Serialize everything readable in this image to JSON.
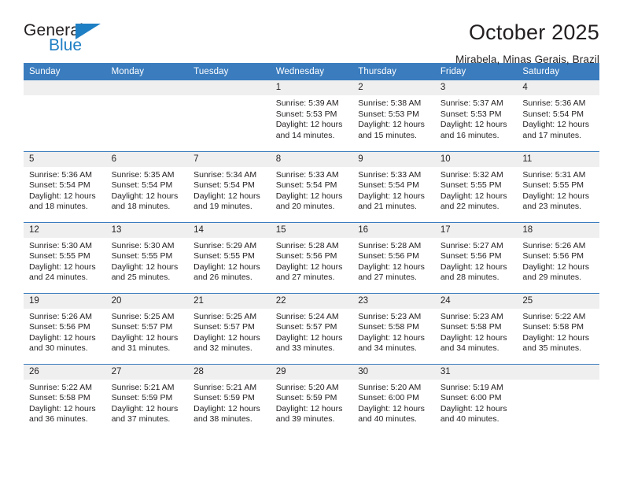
{
  "brand": {
    "name_part1": "General",
    "name_part2": "Blue",
    "triangle_icon": "triangle-icon",
    "accent_color": "#1f7fc4"
  },
  "header": {
    "title": "October 2025",
    "location": "Mirabela, Minas Gerais, Brazil"
  },
  "calendar": {
    "header_bg": "#3a7cbe",
    "daynum_bg": "#efefef",
    "weekdays": [
      "Sunday",
      "Monday",
      "Tuesday",
      "Wednesday",
      "Thursday",
      "Friday",
      "Saturday"
    ],
    "weeks": [
      [
        {
          "day": "",
          "sunrise": "",
          "sunset": "",
          "daylight_line1": "",
          "daylight_line2": ""
        },
        {
          "day": "",
          "sunrise": "",
          "sunset": "",
          "daylight_line1": "",
          "daylight_line2": ""
        },
        {
          "day": "",
          "sunrise": "",
          "sunset": "",
          "daylight_line1": "",
          "daylight_line2": ""
        },
        {
          "day": "1",
          "sunrise": "Sunrise: 5:39 AM",
          "sunset": "Sunset: 5:53 PM",
          "daylight_line1": "Daylight: 12 hours",
          "daylight_line2": "and 14 minutes."
        },
        {
          "day": "2",
          "sunrise": "Sunrise: 5:38 AM",
          "sunset": "Sunset: 5:53 PM",
          "daylight_line1": "Daylight: 12 hours",
          "daylight_line2": "and 15 minutes."
        },
        {
          "day": "3",
          "sunrise": "Sunrise: 5:37 AM",
          "sunset": "Sunset: 5:53 PM",
          "daylight_line1": "Daylight: 12 hours",
          "daylight_line2": "and 16 minutes."
        },
        {
          "day": "4",
          "sunrise": "Sunrise: 5:36 AM",
          "sunset": "Sunset: 5:54 PM",
          "daylight_line1": "Daylight: 12 hours",
          "daylight_line2": "and 17 minutes."
        }
      ],
      [
        {
          "day": "5",
          "sunrise": "Sunrise: 5:36 AM",
          "sunset": "Sunset: 5:54 PM",
          "daylight_line1": "Daylight: 12 hours",
          "daylight_line2": "and 18 minutes."
        },
        {
          "day": "6",
          "sunrise": "Sunrise: 5:35 AM",
          "sunset": "Sunset: 5:54 PM",
          "daylight_line1": "Daylight: 12 hours",
          "daylight_line2": "and 18 minutes."
        },
        {
          "day": "7",
          "sunrise": "Sunrise: 5:34 AM",
          "sunset": "Sunset: 5:54 PM",
          "daylight_line1": "Daylight: 12 hours",
          "daylight_line2": "and 19 minutes."
        },
        {
          "day": "8",
          "sunrise": "Sunrise: 5:33 AM",
          "sunset": "Sunset: 5:54 PM",
          "daylight_line1": "Daylight: 12 hours",
          "daylight_line2": "and 20 minutes."
        },
        {
          "day": "9",
          "sunrise": "Sunrise: 5:33 AM",
          "sunset": "Sunset: 5:54 PM",
          "daylight_line1": "Daylight: 12 hours",
          "daylight_line2": "and 21 minutes."
        },
        {
          "day": "10",
          "sunrise": "Sunrise: 5:32 AM",
          "sunset": "Sunset: 5:55 PM",
          "daylight_line1": "Daylight: 12 hours",
          "daylight_line2": "and 22 minutes."
        },
        {
          "day": "11",
          "sunrise": "Sunrise: 5:31 AM",
          "sunset": "Sunset: 5:55 PM",
          "daylight_line1": "Daylight: 12 hours",
          "daylight_line2": "and 23 minutes."
        }
      ],
      [
        {
          "day": "12",
          "sunrise": "Sunrise: 5:30 AM",
          "sunset": "Sunset: 5:55 PM",
          "daylight_line1": "Daylight: 12 hours",
          "daylight_line2": "and 24 minutes."
        },
        {
          "day": "13",
          "sunrise": "Sunrise: 5:30 AM",
          "sunset": "Sunset: 5:55 PM",
          "daylight_line1": "Daylight: 12 hours",
          "daylight_line2": "and 25 minutes."
        },
        {
          "day": "14",
          "sunrise": "Sunrise: 5:29 AM",
          "sunset": "Sunset: 5:55 PM",
          "daylight_line1": "Daylight: 12 hours",
          "daylight_line2": "and 26 minutes."
        },
        {
          "day": "15",
          "sunrise": "Sunrise: 5:28 AM",
          "sunset": "Sunset: 5:56 PM",
          "daylight_line1": "Daylight: 12 hours",
          "daylight_line2": "and 27 minutes."
        },
        {
          "day": "16",
          "sunrise": "Sunrise: 5:28 AM",
          "sunset": "Sunset: 5:56 PM",
          "daylight_line1": "Daylight: 12 hours",
          "daylight_line2": "and 27 minutes."
        },
        {
          "day": "17",
          "sunrise": "Sunrise: 5:27 AM",
          "sunset": "Sunset: 5:56 PM",
          "daylight_line1": "Daylight: 12 hours",
          "daylight_line2": "and 28 minutes."
        },
        {
          "day": "18",
          "sunrise": "Sunrise: 5:26 AM",
          "sunset": "Sunset: 5:56 PM",
          "daylight_line1": "Daylight: 12 hours",
          "daylight_line2": "and 29 minutes."
        }
      ],
      [
        {
          "day": "19",
          "sunrise": "Sunrise: 5:26 AM",
          "sunset": "Sunset: 5:56 PM",
          "daylight_line1": "Daylight: 12 hours",
          "daylight_line2": "and 30 minutes."
        },
        {
          "day": "20",
          "sunrise": "Sunrise: 5:25 AM",
          "sunset": "Sunset: 5:57 PM",
          "daylight_line1": "Daylight: 12 hours",
          "daylight_line2": "and 31 minutes."
        },
        {
          "day": "21",
          "sunrise": "Sunrise: 5:25 AM",
          "sunset": "Sunset: 5:57 PM",
          "daylight_line1": "Daylight: 12 hours",
          "daylight_line2": "and 32 minutes."
        },
        {
          "day": "22",
          "sunrise": "Sunrise: 5:24 AM",
          "sunset": "Sunset: 5:57 PM",
          "daylight_line1": "Daylight: 12 hours",
          "daylight_line2": "and 33 minutes."
        },
        {
          "day": "23",
          "sunrise": "Sunrise: 5:23 AM",
          "sunset": "Sunset: 5:58 PM",
          "daylight_line1": "Daylight: 12 hours",
          "daylight_line2": "and 34 minutes."
        },
        {
          "day": "24",
          "sunrise": "Sunrise: 5:23 AM",
          "sunset": "Sunset: 5:58 PM",
          "daylight_line1": "Daylight: 12 hours",
          "daylight_line2": "and 34 minutes."
        },
        {
          "day": "25",
          "sunrise": "Sunrise: 5:22 AM",
          "sunset": "Sunset: 5:58 PM",
          "daylight_line1": "Daylight: 12 hours",
          "daylight_line2": "and 35 minutes."
        }
      ],
      [
        {
          "day": "26",
          "sunrise": "Sunrise: 5:22 AM",
          "sunset": "Sunset: 5:58 PM",
          "daylight_line1": "Daylight: 12 hours",
          "daylight_line2": "and 36 minutes."
        },
        {
          "day": "27",
          "sunrise": "Sunrise: 5:21 AM",
          "sunset": "Sunset: 5:59 PM",
          "daylight_line1": "Daylight: 12 hours",
          "daylight_line2": "and 37 minutes."
        },
        {
          "day": "28",
          "sunrise": "Sunrise: 5:21 AM",
          "sunset": "Sunset: 5:59 PM",
          "daylight_line1": "Daylight: 12 hours",
          "daylight_line2": "and 38 minutes."
        },
        {
          "day": "29",
          "sunrise": "Sunrise: 5:20 AM",
          "sunset": "Sunset: 5:59 PM",
          "daylight_line1": "Daylight: 12 hours",
          "daylight_line2": "and 39 minutes."
        },
        {
          "day": "30",
          "sunrise": "Sunrise: 5:20 AM",
          "sunset": "Sunset: 6:00 PM",
          "daylight_line1": "Daylight: 12 hours",
          "daylight_line2": "and 40 minutes."
        },
        {
          "day": "31",
          "sunrise": "Sunrise: 5:19 AM",
          "sunset": "Sunset: 6:00 PM",
          "daylight_line1": "Daylight: 12 hours",
          "daylight_line2": "and 40 minutes."
        },
        {
          "day": "",
          "sunrise": "",
          "sunset": "",
          "daylight_line1": "",
          "daylight_line2": ""
        }
      ]
    ]
  }
}
